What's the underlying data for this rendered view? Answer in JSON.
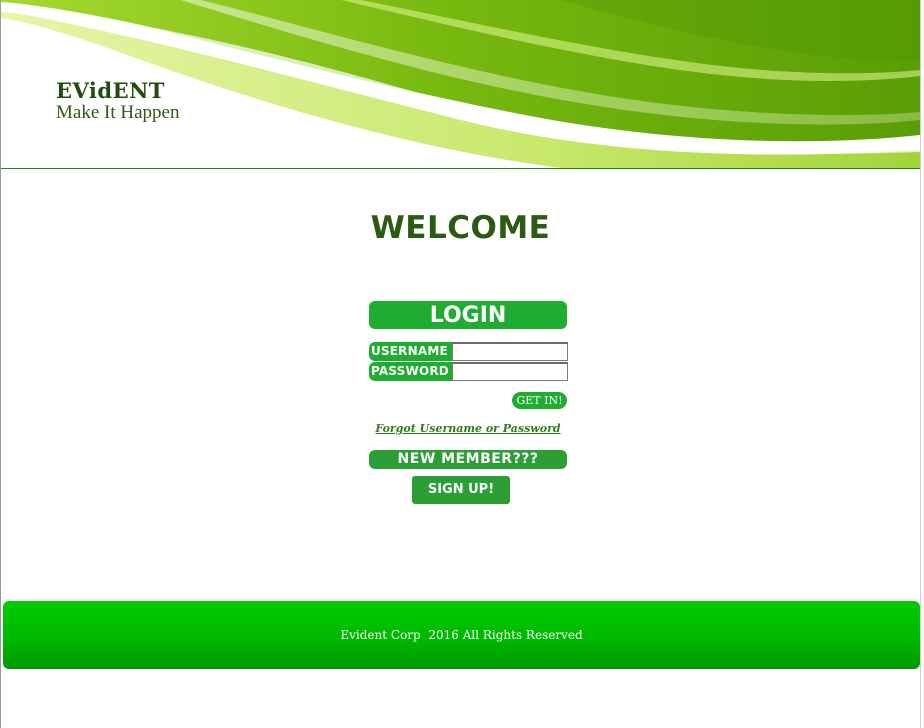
{
  "header": {
    "brand_name": "EVidENT",
    "tagline": "Make It Happen"
  },
  "main": {
    "welcome": "WELCOME",
    "login_title": "LOGIN",
    "username_label": "USERNAME",
    "username_value": "",
    "password_label": "PASSWORD",
    "password_value": "",
    "submit_label": "GET IN!",
    "forgot_link": "Forgot Username or Password",
    "new_member_heading": "NEW MEMBER???",
    "signup_label": "SIGN UP!"
  },
  "footer": {
    "copyright": "Evident Corp  2016 All Rights Reserved"
  },
  "colors": {
    "brand_green": "#1fad31",
    "dark_green_text": "#2b5b12",
    "footer_green": "#00b800"
  }
}
